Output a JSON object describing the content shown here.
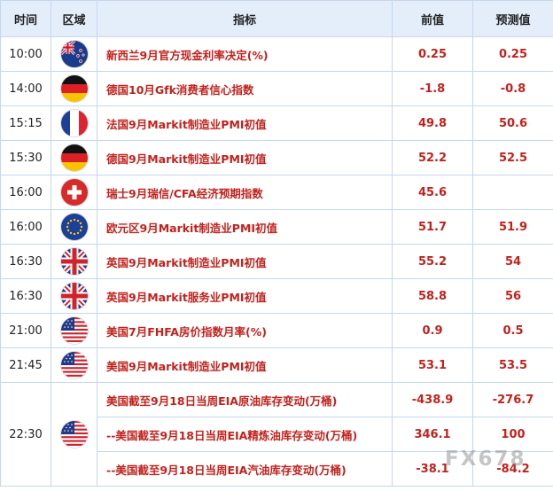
{
  "header": {
    "time": "时间",
    "region": "区域",
    "indicator": "指标",
    "previous": "前值",
    "forecast": "预测值"
  },
  "rows": [
    {
      "time": "10:00",
      "flag": "new-zealand-flag-icon",
      "indicator": "新西兰9月官方现金利率决定(%)",
      "previous": "0.25",
      "forecast": "0.25"
    },
    {
      "time": "14:00",
      "flag": "germany-flag-icon",
      "indicator": "德国10月Gfk消费者信心指数",
      "previous": "-1.8",
      "forecast": "-0.8"
    },
    {
      "time": "15:15",
      "flag": "france-flag-icon",
      "indicator": "法国9月Markit制造业PMI初值",
      "previous": "49.8",
      "forecast": "50.6"
    },
    {
      "time": "15:30",
      "flag": "germany-flag-icon",
      "indicator": "德国9月Markit制造业PMI初值",
      "previous": "52.2",
      "forecast": "52.5"
    },
    {
      "time": "16:00",
      "flag": "switzerland-flag-icon",
      "indicator": "瑞士9月瑞信/CFA经济预期指数",
      "previous": "45.6",
      "forecast": ""
    },
    {
      "time": "16:00",
      "flag": "eurozone-flag-icon",
      "indicator": "欧元区9月Markit制造业PMI初值",
      "previous": "51.7",
      "forecast": "51.9"
    },
    {
      "time": "16:30",
      "flag": "uk-flag-icon",
      "indicator": "英国9月Markit制造业PMI初值",
      "previous": "55.2",
      "forecast": "54"
    },
    {
      "time": "16:30",
      "flag": "uk-flag-icon",
      "indicator": "英国9月Markit服务业PMI初值",
      "previous": "58.8",
      "forecast": "56"
    },
    {
      "time": "21:00",
      "flag": "usa-flag-icon",
      "indicator": "美国7月FHFA房价指数月率(%)",
      "previous": "0.9",
      "forecast": "0.5"
    },
    {
      "time": "21:45",
      "flag": "usa-flag-icon",
      "indicator": "美国9月Markit制造业PMI初值",
      "previous": "53.1",
      "forecast": "53.5"
    }
  ],
  "group": {
    "time": "22:30",
    "flag": "usa-flag-icon",
    "items": [
      {
        "indicator": "美国截至9月18日当周EIA原油库存变动(万桶)",
        "previous": "-438.9",
        "forecast": "-276.7"
      },
      {
        "indicator": "--美国截至9月18日当周EIA精炼油库存变动(万桶)",
        "previous": "346.1",
        "forecast": "100"
      },
      {
        "indicator": "--美国截至9月18日当周EIA汽油库存变动(万桶)",
        "previous": "-38.1",
        "forecast": "-84.2"
      }
    ]
  },
  "watermark": "FX678",
  "colors": {
    "header_bg": "#e3eefa",
    "border": "#c5d7ec",
    "accent_red": "#c1221d"
  }
}
